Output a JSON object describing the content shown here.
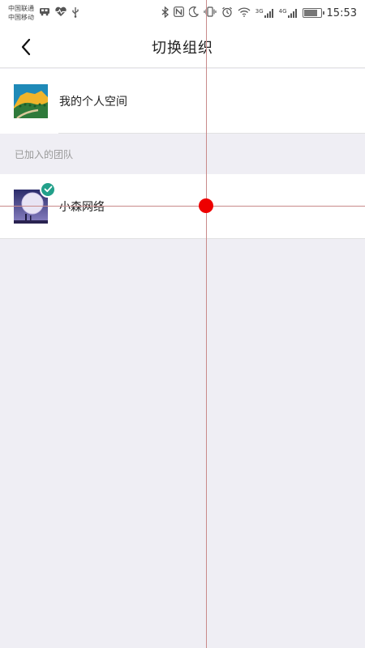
{
  "status_bar": {
    "carrier_1": "中国联通",
    "carrier_2": "中国移动",
    "network_3g": "3G",
    "network_4g": "4G",
    "time": "15:53",
    "left_icons": [
      "bus-icon",
      "heartbeat-icon",
      "usb-icon"
    ],
    "right_icons": [
      "bluetooth-icon",
      "nfc-icon",
      "moon-icon",
      "vibrate-icon",
      "alarm-icon",
      "wifi-icon",
      "signal-icon",
      "signal-icon",
      "battery-icon"
    ]
  },
  "header": {
    "title": "切换组织",
    "back_icon": "chevron-left-icon"
  },
  "personal_space": {
    "label": "我的个人空间"
  },
  "section": {
    "joined_teams_label": "已加入的团队"
  },
  "teams": [
    {
      "label": "小森网络",
      "selected": true
    }
  ],
  "colors": {
    "accent_check": "#22a08a",
    "page_background": "#efeef4",
    "overlay_marker": "#ee0000"
  }
}
